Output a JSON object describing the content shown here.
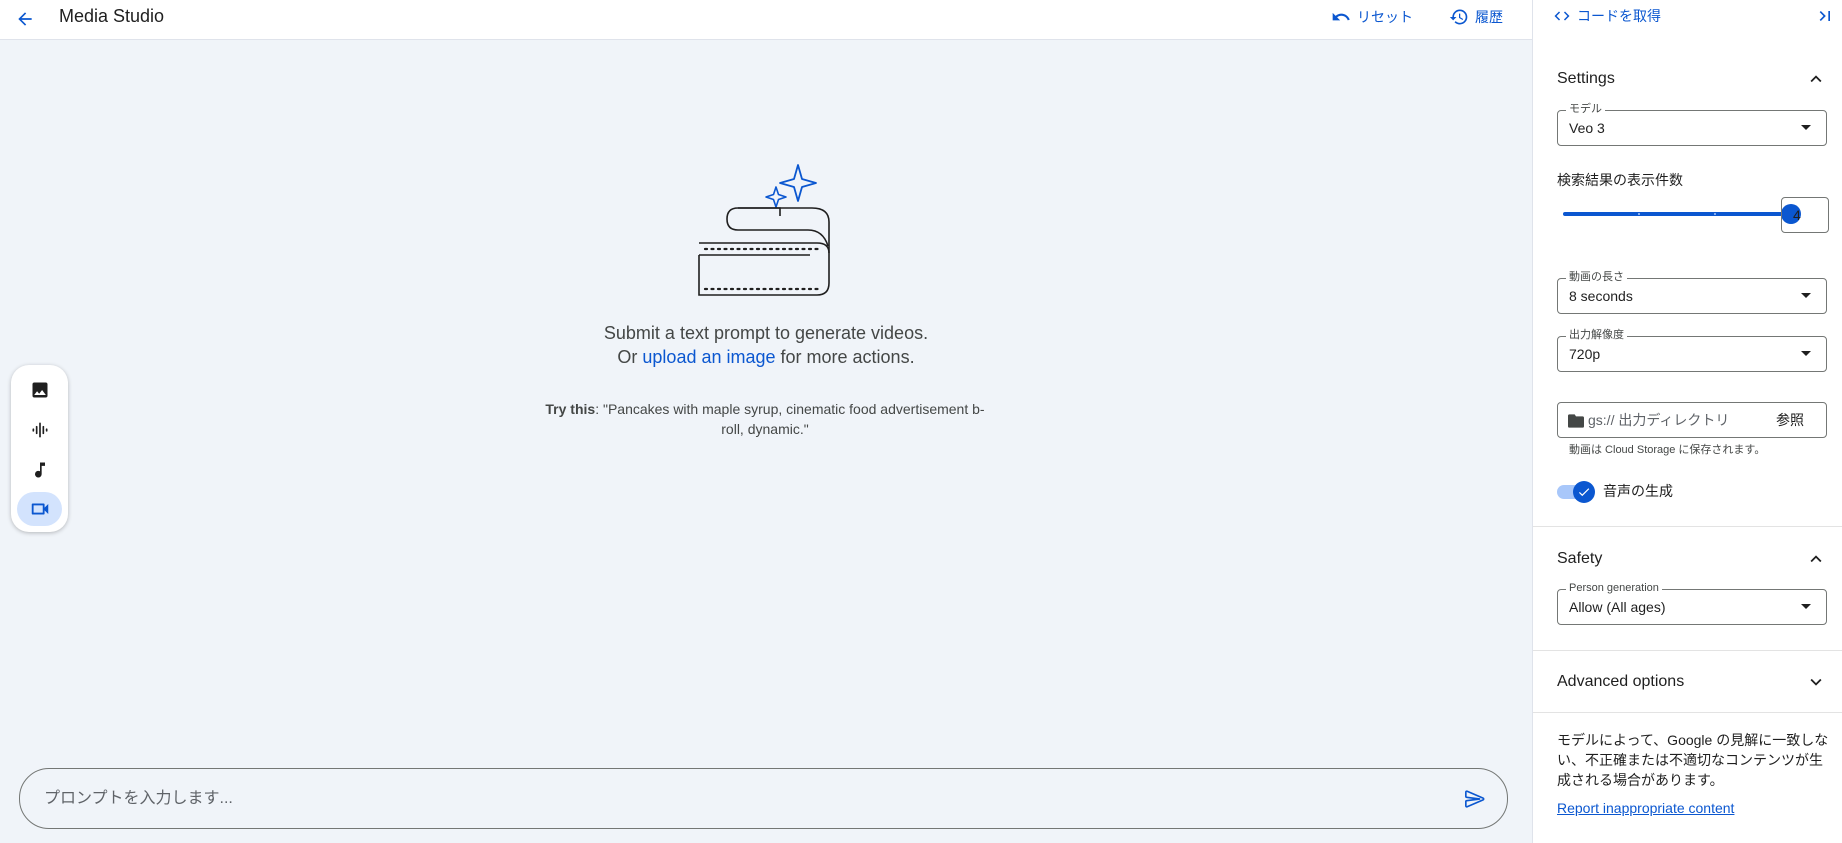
{
  "header": {
    "title": "Media Studio",
    "reset_label": "リセット",
    "history_label": "履歴"
  },
  "empty_state": {
    "line1": "Submit a text prompt to generate videos.",
    "line2_prefix": "Or ",
    "line2_link": "upload an image",
    "line2_suffix": " for more actions.",
    "try_label": "Try this",
    "try_text": ": \"Pancakes with maple syrup, cinematic food advertisement b-roll, dynamic.\""
  },
  "media_types": [
    {
      "icon": "image-icon",
      "active": false
    },
    {
      "icon": "audio-waveform-icon",
      "active": false
    },
    {
      "icon": "music-note-icon",
      "active": false
    },
    {
      "icon": "videocam-icon",
      "active": true
    }
  ],
  "prompt": {
    "value": "",
    "placeholder": "プロンプトを入力します..."
  },
  "panel": {
    "get_code_label": "コードを取得",
    "settings": {
      "title": "Settings",
      "model": {
        "label": "モデル",
        "value": "Veo 3"
      },
      "result_count": {
        "label": "検索結果の表示件数",
        "value": "4",
        "min": 1,
        "max": 4
      },
      "duration": {
        "label": "動画の長さ",
        "value": "8 seconds"
      },
      "resolution": {
        "label": "出力解像度",
        "value": "720p"
      },
      "output_dir": {
        "placeholder": "gs:// 出力ディレクトリ",
        "value": "",
        "browse_label": "参照",
        "hint": "動画は Cloud Storage に保存されます。"
      },
      "audio": {
        "label": "音声の生成",
        "enabled": true
      }
    },
    "safety": {
      "title": "Safety",
      "person_generation": {
        "label": "Person generation",
        "value": "Allow (All ages)"
      }
    },
    "advanced": {
      "title": "Advanced options"
    },
    "disclaimer": "モデルによって、Google の見解に一致しない、不正確または不適切なコンテンツが生成される場合があります。",
    "report_label": "Report inappropriate content"
  },
  "colors": {
    "accent": "#0b57d0",
    "accent_light": "#d3e3fd",
    "canvas_bg": "#f0f4f9",
    "panel_bg": "#ffffff"
  }
}
